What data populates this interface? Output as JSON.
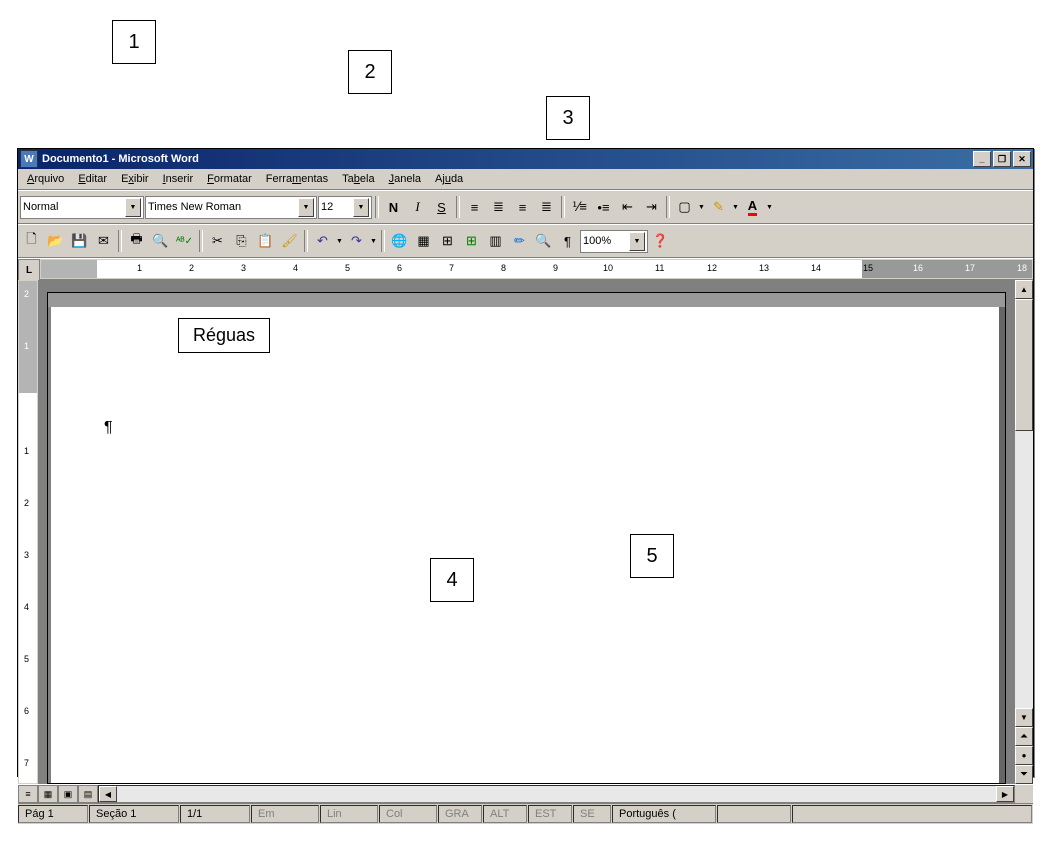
{
  "callouts": {
    "c1": "1",
    "c2": "2",
    "c3": "3",
    "c4": "4",
    "c5": "5",
    "reguas": "Réguas"
  },
  "title": "Documento1 - Microsoft Word",
  "winbtns": {
    "min": "_",
    "max": "❐",
    "close": "✕"
  },
  "menu": {
    "arquivo": "Arquivo",
    "editar": "Editar",
    "exibir": "Exibir",
    "inserir": "Inserir",
    "formatar": "Formatar",
    "ferramentas": "Ferramentas",
    "tabela": "Tabela",
    "janela": "Janela",
    "ajuda": "Ajuda"
  },
  "format": {
    "style": "Normal",
    "font": "Times New Roman",
    "size": "12",
    "bold": "N",
    "italic": "I",
    "underline": "S"
  },
  "std": {
    "zoom": "100%"
  },
  "ruler": {
    "h": [
      "1",
      "2",
      "3",
      "4",
      "5",
      "6",
      "7",
      "8",
      "9",
      "10",
      "11",
      "12",
      "13",
      "14",
      "15",
      "16",
      "17",
      "18"
    ],
    "v": [
      "2",
      "1",
      "1",
      "2",
      "3",
      "4",
      "5",
      "6",
      "7"
    ]
  },
  "doc": {
    "para": "¶"
  },
  "status": {
    "page": "Pág 1",
    "section": "Seção 1",
    "pages": "1/1",
    "at": "Em",
    "line": "Lin",
    "col": "Col",
    "gra": "GRA",
    "alt": "ALT",
    "est": "EST",
    "se": "SE",
    "lang": "Português ("
  }
}
